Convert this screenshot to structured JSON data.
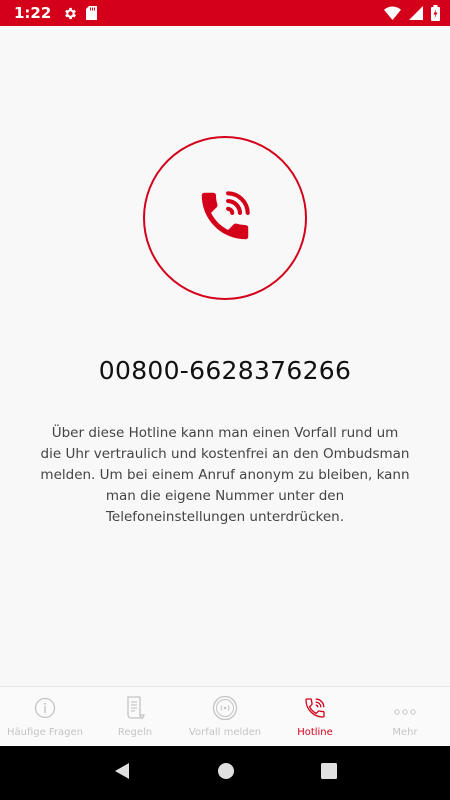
{
  "status_bar": {
    "time": "1:22",
    "left_icons": [
      "gear-icon",
      "sd-card-icon"
    ],
    "right_icons": [
      "wifi-icon",
      "signal-icon",
      "battery-icon"
    ],
    "color": "#d4001a"
  },
  "hotline": {
    "icon": "phone-calling-icon",
    "number": "00800-6628376266",
    "description": "Über diese Hotline kann man einen Vorfall rund um die Uhr vertraulich und kostenfrei an den Ombudsman melden. Um bei einem Anruf anonym zu bleiben, kann man die eigene Nummer unter den Telefoneinstellungen unterdrücken."
  },
  "bottom_nav": {
    "active_color": "#d4001a",
    "inactive_color": "#c4c4c4",
    "items": [
      {
        "label": "Häufige Fragen",
        "icon": "info-icon"
      },
      {
        "label": "Regeln",
        "icon": "document-icon"
      },
      {
        "label": "Vorfall melden",
        "icon": "broadcast-icon"
      },
      {
        "label": "Hotline",
        "icon": "phone-calling-icon",
        "active": true
      },
      {
        "label": "Mehr",
        "icon": "more-dots-icon"
      }
    ]
  },
  "system_nav": {
    "icons": [
      "back-icon",
      "home-icon",
      "recents-icon"
    ]
  }
}
